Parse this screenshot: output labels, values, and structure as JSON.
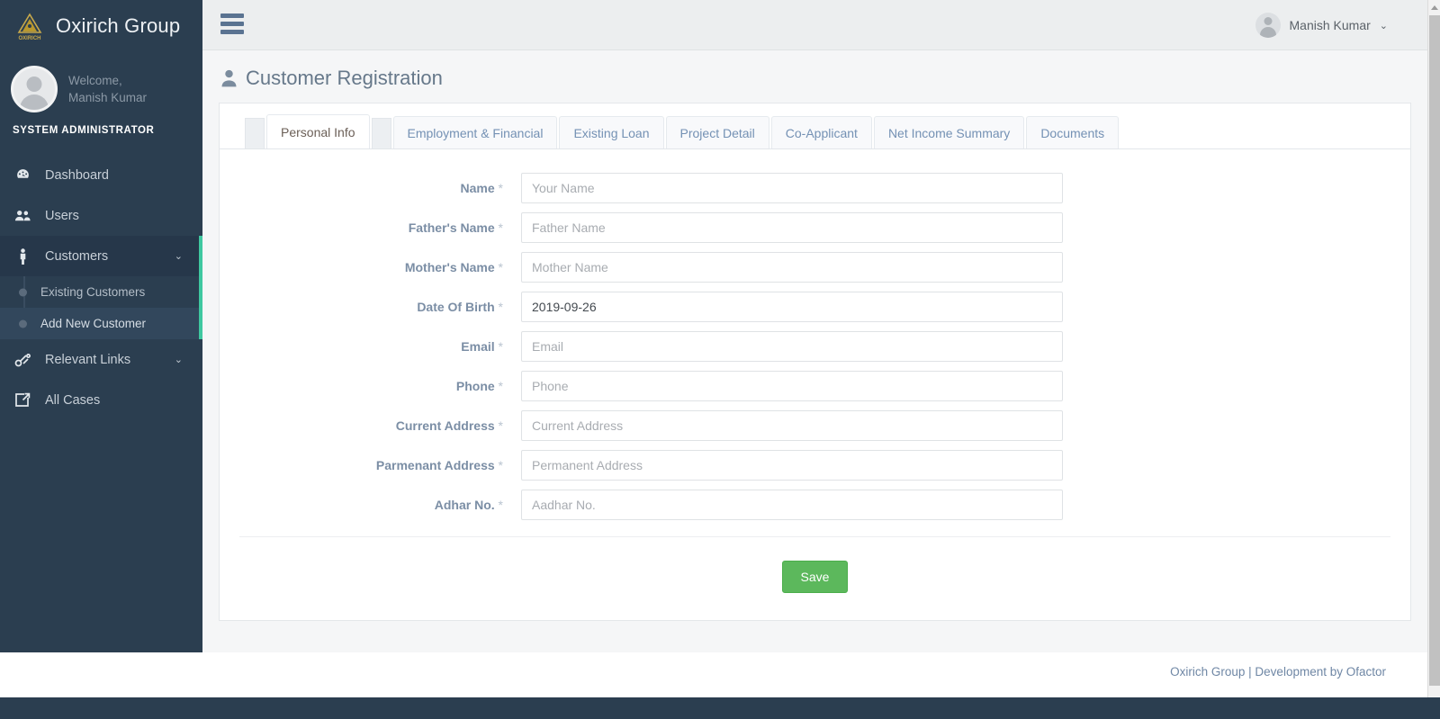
{
  "sidebar": {
    "brand": {
      "title": "Oxirich Group",
      "logo_icon": "oxirich-triangle-logo",
      "logo_text": "OXIRICH"
    },
    "profile": {
      "welcome_line1": "Welcome,",
      "welcome_line2": "Manish Kumar",
      "role": "SYSTEM ADMINISTRATOR",
      "avatar_icon": "user-avatar-icon"
    },
    "accent_color": "#3fc8a0",
    "background_color": "#2b3e50",
    "items": [
      {
        "label": "Dashboard",
        "icon": "dashboard-icon",
        "expandable": false
      },
      {
        "label": "Users",
        "icon": "users-icon",
        "expandable": false
      },
      {
        "label": "Customers",
        "icon": "person-icon",
        "expandable": true,
        "caret": "⌄",
        "expanded": true,
        "children": [
          {
            "label": "Existing Customers",
            "active": false
          },
          {
            "label": "Add New Customer",
            "active": true
          }
        ]
      },
      {
        "label": "Relevant Links",
        "icon": "link-icon",
        "expandable": true,
        "caret": "⌄",
        "expanded": false
      },
      {
        "label": "All Cases",
        "icon": "external-link-icon",
        "expandable": false
      }
    ]
  },
  "topbar": {
    "menu_toggle_icon": "hamburger-icon",
    "user_name": "Manish Kumar",
    "user_caret": "⌄",
    "avatar_icon": "user-avatar-icon"
  },
  "page": {
    "title": "Customer Registration",
    "title_icon": "person-icon"
  },
  "tabs": [
    {
      "label": "Personal Info",
      "active": true
    },
    {
      "label": "Employment & Financial",
      "active": false
    },
    {
      "label": "Existing Loan",
      "active": false
    },
    {
      "label": "Project Detail",
      "active": false
    },
    {
      "label": "Co-Applicant",
      "active": false
    },
    {
      "label": "Net Income Summary",
      "active": false
    },
    {
      "label": "Documents",
      "active": false
    }
  ],
  "form": {
    "required_marker": "*",
    "fields": [
      {
        "name": "name",
        "label": "Name",
        "placeholder": "Your Name",
        "value": "",
        "required": true
      },
      {
        "name": "fathers-name",
        "label": "Father's Name",
        "placeholder": "Father Name",
        "value": "",
        "required": true
      },
      {
        "name": "mothers-name",
        "label": "Mother's Name",
        "placeholder": "Mother Name",
        "value": "",
        "required": true
      },
      {
        "name": "date-of-birth",
        "label": "Date Of Birth",
        "placeholder": "",
        "value": "2019-09-26",
        "required": true
      },
      {
        "name": "email",
        "label": "Email",
        "placeholder": "Email",
        "value": "",
        "required": true
      },
      {
        "name": "phone",
        "label": "Phone",
        "placeholder": "Phone",
        "value": "",
        "required": true
      },
      {
        "name": "current-address",
        "label": "Current Address",
        "placeholder": "Current Address",
        "value": "",
        "required": true
      },
      {
        "name": "permanent-address",
        "label": "Parmenant Address",
        "placeholder": "Permanent Address",
        "value": "",
        "required": true
      },
      {
        "name": "aadhar-no",
        "label": "Adhar No.",
        "placeholder": "Aadhar No.",
        "value": "",
        "required": true
      }
    ],
    "save_label": "Save",
    "save_color": "#5cb85c"
  },
  "footer": {
    "text": "Oxirich Group | Development by Ofactor"
  },
  "scrollbar": {
    "up_arrow_icon": "scroll-up-arrow-icon"
  }
}
